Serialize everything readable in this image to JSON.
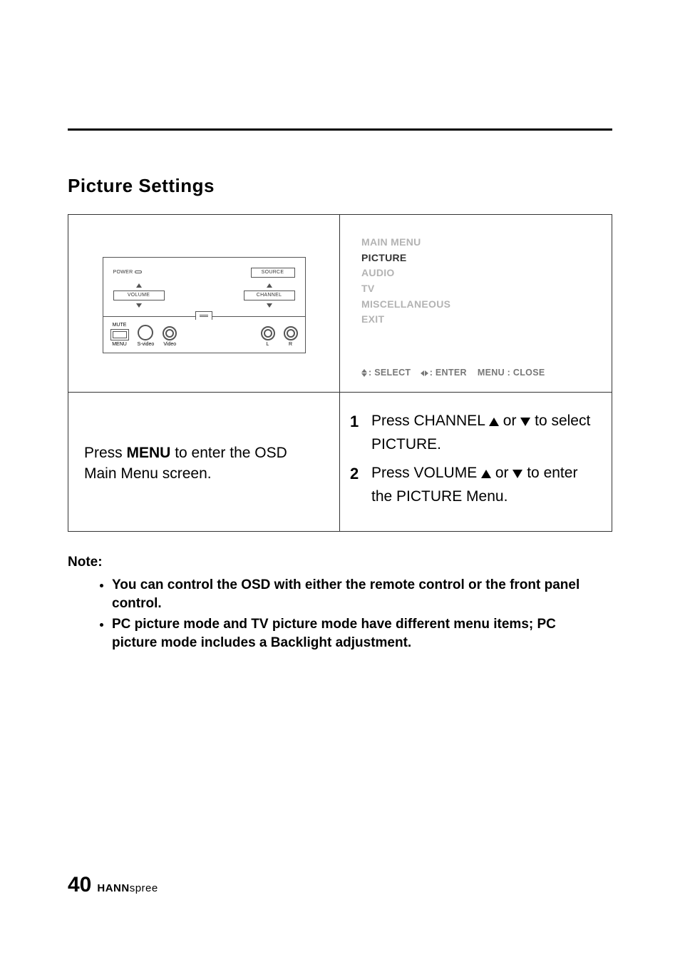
{
  "section_title": "Picture Settings",
  "panel": {
    "power": "POWER",
    "source": "SOURCE",
    "volume": "VOLUME",
    "channel": "CHANNEL",
    "mute": "MUTE",
    "menu": "MENU",
    "svideo": "S-video",
    "video": "Video",
    "l": "L",
    "r": "R"
  },
  "osd": {
    "title": "MAIN MENU",
    "items": [
      "PICTURE",
      "AUDIO",
      "TV",
      "MISCELLANEOUS",
      "EXIT"
    ],
    "selected_index": 0,
    "hint_select": ": SELECT",
    "hint_enter": ": ENTER",
    "hint_close": "MENU : CLOSE"
  },
  "left_instruction": {
    "prefix": "Press ",
    "bold": "MENU",
    "suffix": " to enter the OSD Main Menu screen."
  },
  "steps": [
    {
      "num": "1",
      "pre": "Press CHANNEL ",
      "mid": " or ",
      "post": " to select PICTURE."
    },
    {
      "num": "2",
      "pre": "Press VOLUME ",
      "mid": " or ",
      "post": " to enter the PICTURE Menu."
    }
  ],
  "note": {
    "title": "Note:",
    "items": [
      "You can control the OSD with either the remote control or the front panel  control.",
      "PC picture mode and TV picture mode have different menu items; PC picture mode includes a Backlight adjustment."
    ]
  },
  "footer": {
    "page": "40",
    "brand_bold": "HANN",
    "brand_light": "spree"
  }
}
